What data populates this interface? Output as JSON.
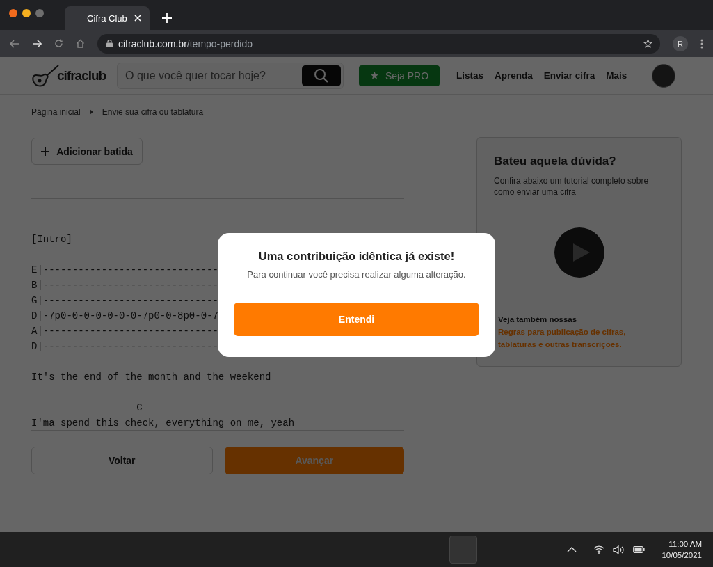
{
  "browser": {
    "tab_title": "Cifra Club",
    "url_host": "cifraclub.com.br",
    "url_path": "/tempo-perdido",
    "profile_initial": "R"
  },
  "header": {
    "logo": "cifraclub",
    "search": {
      "placeholder": "O que você quer tocar hoje?"
    },
    "pro_button": "Seja PRO",
    "nav": [
      "Listas",
      "Aprenda",
      "Enviar cifra",
      "Mais"
    ]
  },
  "breadcrumb": [
    "Página inicial",
    "Envie sua cifra ou tablatura"
  ],
  "add_strum_button": "Adicionar batida",
  "sheet": [
    [
      "[Intro]"
    ],
    [
      "E|------------------------------",
      "B|------------------------------",
      "G|------------------------------",
      "D|-7p0-0-0-0-0-0-0-7p0-0-8p0-0-7",
      "A|------------------------------",
      "D|------------------------------"
    ],
    [
      "It's the end of the month and the weekend"
    ],
    [
      "                  C",
      "I'ma spend this check, everything on me, yeah"
    ]
  ],
  "footer_buttons": [
    {
      "label": "Voltar",
      "kind": "secondary"
    },
    {
      "label": "Avançar",
      "kind": "primary"
    }
  ],
  "help_card": {
    "title": "Bateu aquela dúvida?",
    "text": "Confira abaixo um tutorial completo sobre como enviar uma cifra",
    "note": "Veja também nossas",
    "link": "Regras para publicação de cifras, tablaturas e outras transcrições."
  },
  "modal": {
    "title": "Uma contribuição idêntica já existe!",
    "message": "Para continuar você precisa realizar alguma alteração.",
    "button": "Entendi"
  },
  "taskbar": {
    "time": "11:00 AM",
    "date": "10/05/2021"
  }
}
